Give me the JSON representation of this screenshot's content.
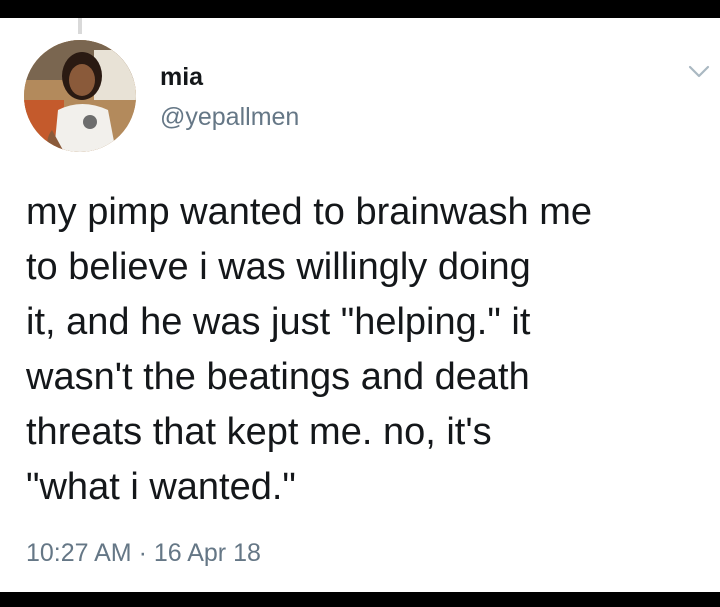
{
  "tweet": {
    "author": {
      "display_name": "mia",
      "handle": "@yepallmen",
      "avatar_icon": "profile-photo"
    },
    "menu_icon": "chevron-down-icon",
    "text": "my pimp wanted to brainwash me\nto believe i was willingly doing\nit, and he was just \"helping.\" it\nwasn't the beatings and death\nthreats that kept me. no, it's\n\"what i wanted.\"",
    "time": "10:27 AM",
    "separator": " · ",
    "date": "16 Apr 18"
  },
  "colors": {
    "background": "#ffffff",
    "frame": "#000000",
    "text": "#14171a",
    "secondary": "#657786",
    "chevron": "#aab8c2"
  }
}
